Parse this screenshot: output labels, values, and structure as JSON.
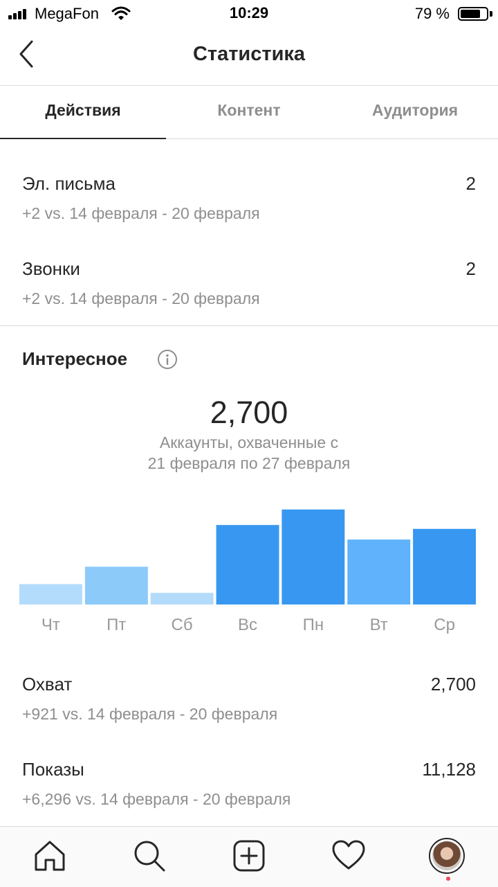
{
  "status_bar": {
    "carrier": "MegaFon",
    "time": "10:29",
    "battery_percent": "79 %",
    "battery_level": 0.79
  },
  "header": {
    "title": "Статистика"
  },
  "tabs": [
    {
      "label": "Действия",
      "active": true
    },
    {
      "label": "Контент",
      "active": false
    },
    {
      "label": "Аудитория",
      "active": false
    }
  ],
  "metrics_top": [
    {
      "label": "Эл. письма",
      "value": "2",
      "comparison": "+2 vs. 14 февраля - 20 февраля"
    },
    {
      "label": "Звонки",
      "value": "2",
      "comparison": "+2 vs. 14 февраля - 20 февраля"
    }
  ],
  "discovery": {
    "title": "Интересное",
    "reach_total": "2,700",
    "reach_caption_line1": "Аккаунты, охваченные с",
    "reach_caption_line2": "21 февраля по 27 февраля"
  },
  "chart_data": {
    "type": "bar",
    "categories": [
      "Чт",
      "Пт",
      "Сб",
      "Вс",
      "Пн",
      "Вт",
      "Ср"
    ],
    "values": [
      21,
      39,
      12,
      82,
      98,
      67,
      78
    ],
    "colors": [
      "#b3dbfb",
      "#8ccafa",
      "#b3dbfb",
      "#3897f0",
      "#3897f0",
      "#5fb2fb",
      "#3897f0"
    ]
  },
  "metrics_bottom": [
    {
      "label": "Охват",
      "value": "2,700",
      "comparison": "+921 vs. 14 февраля - 20 февраля"
    },
    {
      "label": "Показы",
      "value": "11,128",
      "comparison": "+6,296 vs. 14 февраля - 20 февраля"
    }
  ],
  "bottom_nav": {
    "icons": [
      "home-icon",
      "search-icon",
      "new-post-icon",
      "activity-heart-icon",
      "profile-avatar"
    ]
  }
}
